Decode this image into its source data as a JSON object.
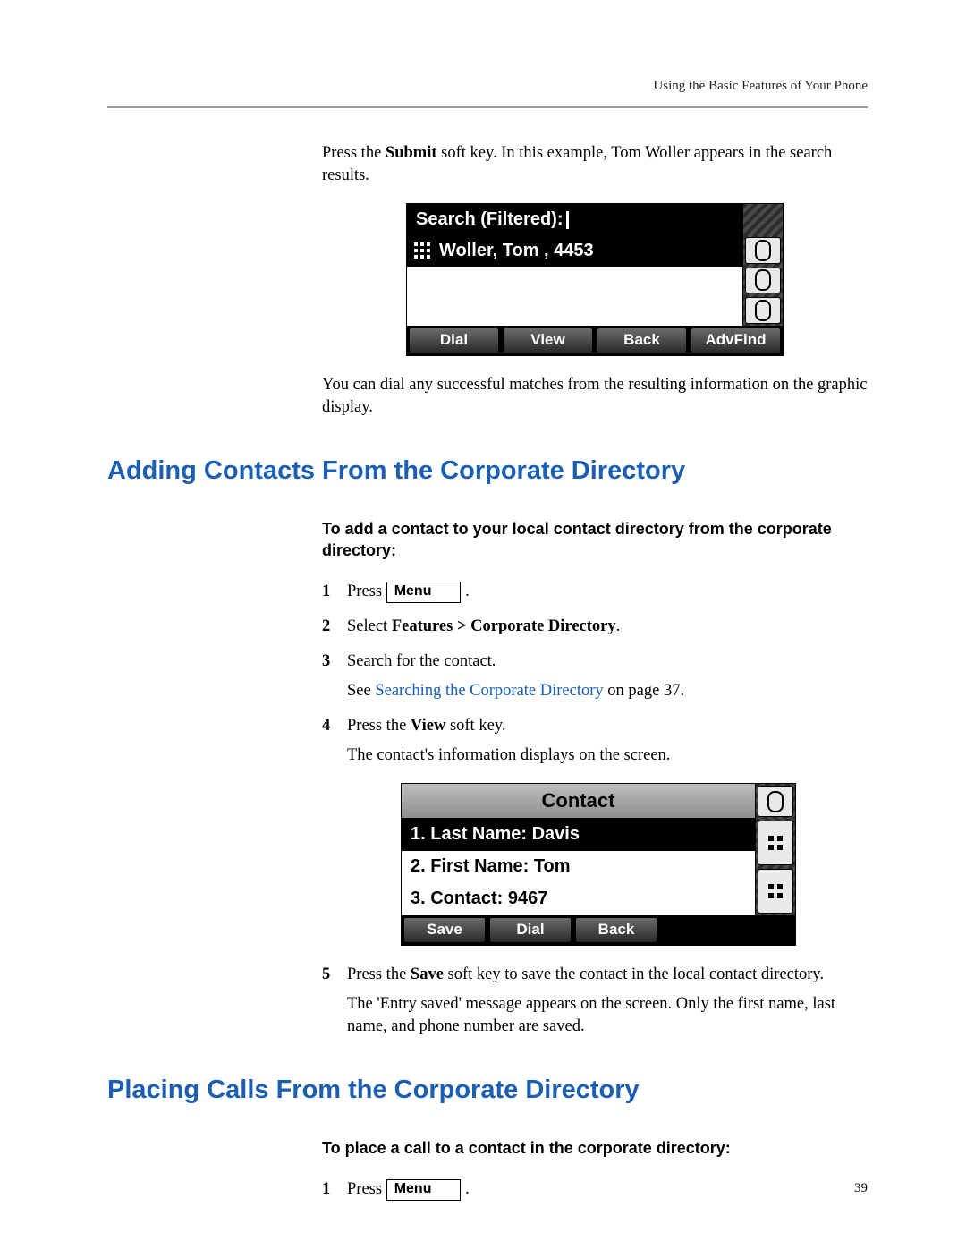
{
  "header": {
    "running": "Using the Basic Features of Your Phone"
  },
  "intro": {
    "p1a": "Press the ",
    "p1b": "Submit",
    "p1c": " soft key. In this example, Tom Woller appears in the search results.",
    "p2": "You can dial any successful matches from the resulting information on the graphic display."
  },
  "screenshot1": {
    "title": "Search (Filtered):",
    "result": "Woller, Tom , 4453",
    "softkeys": [
      "Dial",
      "View",
      "Back",
      "AdvFind"
    ]
  },
  "section1": {
    "heading": "Adding Contacts From the Corporate Directory",
    "lead": "To add a contact to your local contact directory from the corporate directory:",
    "menu_label": "Menu",
    "steps": {
      "s1_a": "Press ",
      "s1_b": " .",
      "s2_a": "Select ",
      "s2_b": "Features > Corporate Directory",
      "s2_c": ".",
      "s3_a": "Search for the contact.",
      "s3_see_a": "See ",
      "s3_link": "Searching the Corporate Directory",
      "s3_see_b": " on page 37.",
      "s4_a": "Press the ",
      "s4_b": "View",
      "s4_c": " soft key.",
      "s4_sub": "The contact's information displays on the screen.",
      "s5_a": "Press the ",
      "s5_b": "Save",
      "s5_c": " soft key to save the contact in the local contact directory.",
      "s5_sub": "The 'Entry saved' message appears on the screen. Only the first name, last name, and phone number are saved."
    }
  },
  "screenshot2": {
    "title": "Contact",
    "rows": [
      "1. Last Name: Davis",
      "2. First Name: Tom",
      "3. Contact: 9467"
    ],
    "softkeys": [
      "Save",
      "Dial",
      "Back"
    ]
  },
  "section2": {
    "heading": "Placing Calls From the Corporate Directory",
    "lead": "To place a call to a contact in the corporate directory:",
    "menu_label": "Menu",
    "steps": {
      "s1_a": "Press ",
      "s1_b": " ."
    }
  },
  "page_number": "39"
}
